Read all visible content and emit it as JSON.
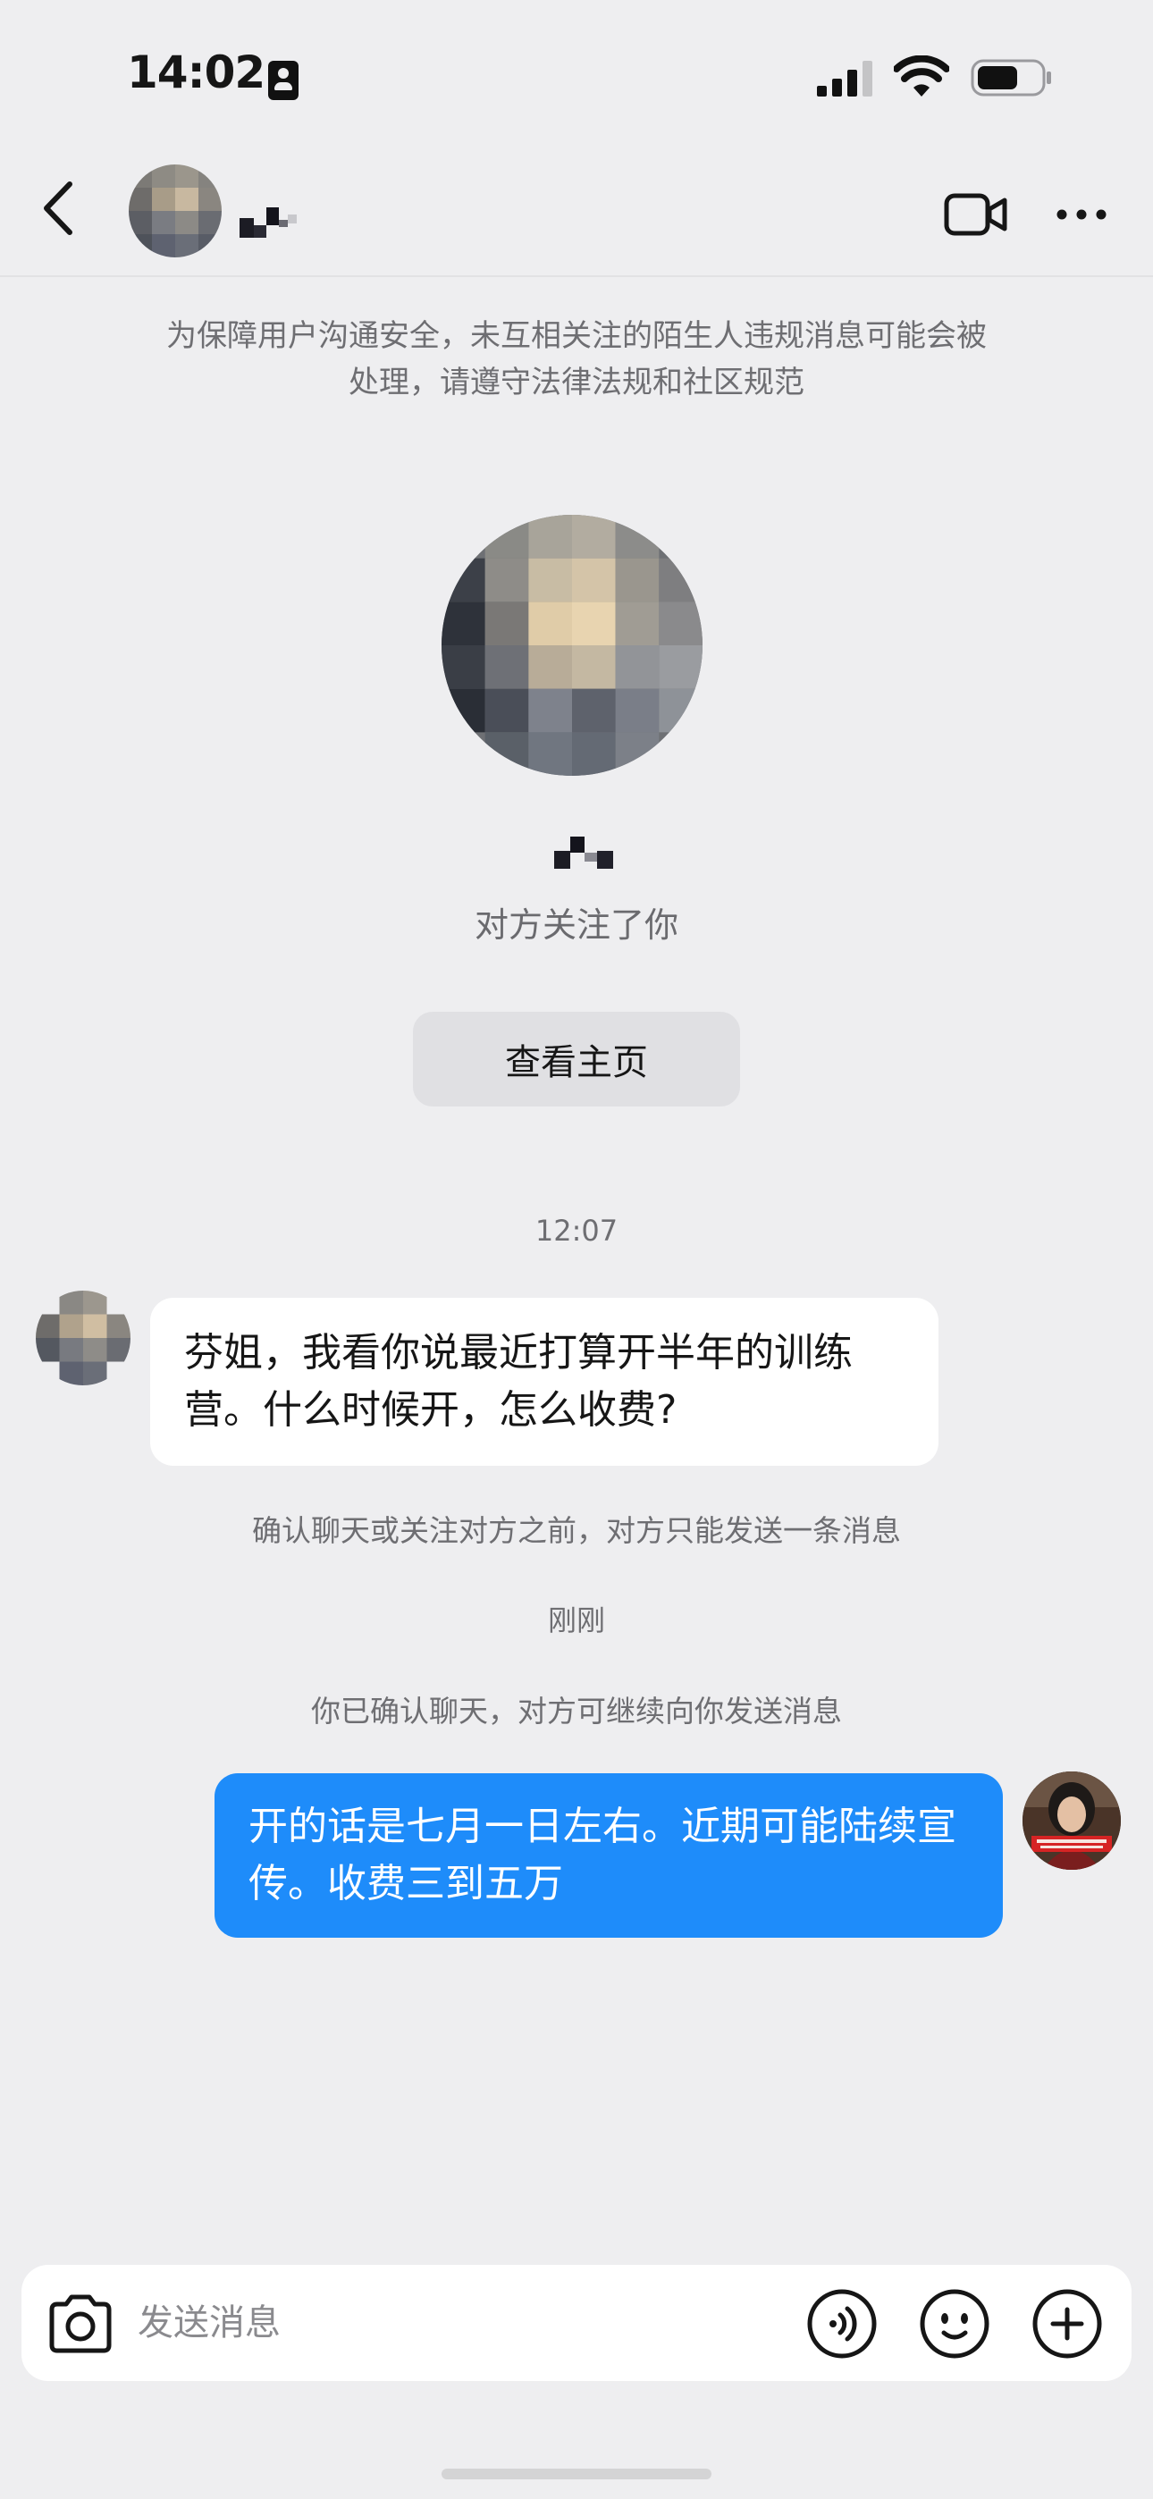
{
  "status_bar": {
    "time": "14:02",
    "battery_level": 0.65
  },
  "nav": {
    "back_icon": "chevron-left-icon",
    "video_icon": "video-call-icon",
    "more_icon": "more-dots-icon"
  },
  "security_notice": {
    "line1": "为保障用户沟通安全，未互相关注的陌生人违规消息可能会被",
    "line2": "处理，请遵守法律法规和社区规范"
  },
  "profile": {
    "follow_status": "对方关注了你",
    "view_profile_label": "查看主页"
  },
  "conversation": {
    "timestamp_1": "12:07",
    "incoming_message": "芬姐，我看你说最近打算开半年的训练营。什么时候开，怎么收费?",
    "notice_one_message": "确认聊天或关注对方之前，对方只能发送一条消息",
    "timestamp_2": "刚刚",
    "notice_confirmed": "你已确认聊天，对方可继续向你发送消息",
    "outgoing_message": "开的话是七月一日左右。近期可能陆续宣传。收费三到五万"
  },
  "input_bar": {
    "placeholder": "发送消息",
    "icons": [
      "camera-icon",
      "voice-icon",
      "emoji-icon",
      "plus-icon"
    ]
  },
  "colors": {
    "background": "#EEEEF0",
    "outgoing_bubble": "#1E8CFA",
    "incoming_bubble": "#FFFFFF",
    "muted_text": "#6E6E72"
  }
}
